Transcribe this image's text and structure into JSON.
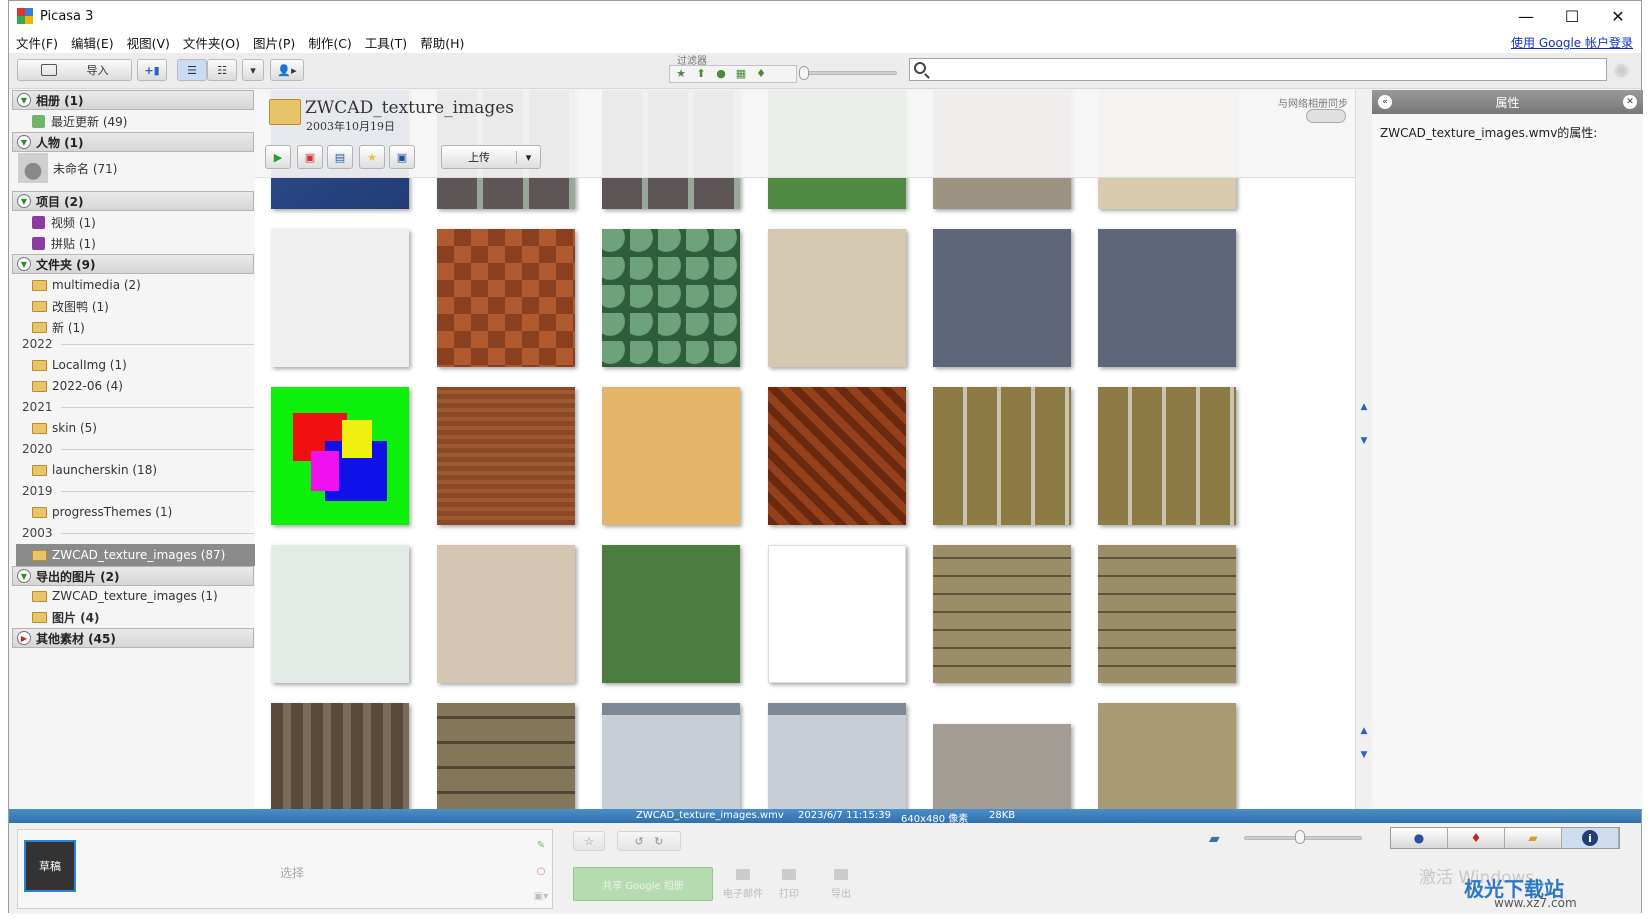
{
  "app": {
    "title": "Picasa 3",
    "signin": "使用 Google 帐户登录"
  },
  "window_controls": {
    "minimize": "—",
    "maximize": "☐",
    "close": "✕"
  },
  "menu": [
    "文件(F)",
    "编辑(E)",
    "视图(V)",
    "文件夹(O)",
    "图片(P)",
    "制作(C)",
    "工具(T)",
    "帮助(H)"
  ],
  "toolbar": {
    "import_label": "导入",
    "filter_label": "过滤器"
  },
  "sidebar": {
    "albums": {
      "label": "相册 (1)",
      "items": [
        "最近更新 (49)"
      ]
    },
    "people": {
      "label": "人物 (1)",
      "items": [
        "未命名 (71)"
      ]
    },
    "projects": {
      "label": "项目 (2)",
      "items": [
        "视频 (1)",
        "拼贴 (1)"
      ]
    },
    "folders": {
      "label": "文件夹 (9)",
      "items": [
        "multimedia (2)",
        "改图鸭 (1)",
        "新 (1)"
      ]
    },
    "years": [
      {
        "year": "2022",
        "items": [
          "LocalImg (1)",
          "2022-06 (4)"
        ]
      },
      {
        "year": "2021",
        "items": [
          "skin (5)"
        ]
      },
      {
        "year": "2020",
        "items": [
          "launcherskin (18)"
        ]
      },
      {
        "year": "2019",
        "items": [
          "progressThemes (1)"
        ]
      },
      {
        "year": "2003",
        "items": [
          "ZWCAD_texture_images (87)"
        ]
      }
    ],
    "exported": {
      "label": "导出的图片 (2)",
      "items": [
        "ZWCAD_texture_images (1)",
        "图片 (4)"
      ]
    },
    "other": {
      "label": "其他素材 (45)"
    }
  },
  "album": {
    "title": "ZWCAD_texture_images",
    "date": "2003年10月19日",
    "sync_label": "与网络相册同步",
    "upload_label": "上传"
  },
  "thumbnails": [
    "blue-fabric",
    "stone-tile",
    "stone-tile",
    "green-grass",
    "gravel",
    "beige-sand",
    "white-plaster",
    "wood-parquet",
    "ivy-leaves",
    "linen-beige",
    "steel-plate",
    "steel-plate",
    "color-shapes",
    "wood-grain",
    "cork",
    "brick-parquet",
    "basket-weave",
    "basket-weave",
    "white-stucco",
    "beige-linen",
    "green-grass",
    "white-blank",
    "wood-shingles",
    "wood-shingles",
    "dark-planks",
    "wood-planks",
    "metal-sheet",
    "metal-sheet",
    "stone-blocks",
    "stone-wall"
  ],
  "properties": {
    "title": "属性",
    "text": "ZWCAD_texture_images.wmv的属性:"
  },
  "status": {
    "file": "ZWCAD_texture_images.wmv",
    "date": "2023/6/7 11:15:39",
    "size": "640x480 像素",
    "filesize": "28KB"
  },
  "tray": {
    "thumb_label": "草稿",
    "select_label": "选择"
  },
  "actions": {
    "share": "共享 Google 相册",
    "email": "电子邮件",
    "print": "打印",
    "export": "导出"
  },
  "watermark": {
    "activate": "激活 Windows",
    "site": "极光下载站",
    "url": "www.xz7.com"
  },
  "colors": {
    "accent": "#2e6fae",
    "selected_row": "#8a8a8a",
    "share_button": "#b7dbb0"
  }
}
